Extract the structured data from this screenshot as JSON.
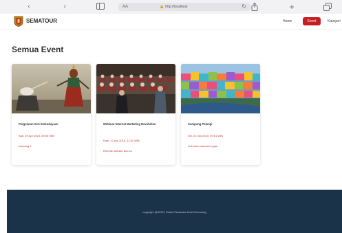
{
  "browser": {
    "text_size_label": "AA",
    "url": "http://localhost"
  },
  "navbar": {
    "brand": "SEMATOUR",
    "home_label": "Home",
    "event_label": "Event",
    "category_label": "Kategori"
  },
  "page": {
    "title": "Semua Event"
  },
  "events": [
    {
      "title": "Pergelaran Seni Kebudayaan",
      "date": "Sab, 29 Apr 2023, 09:00 WIB",
      "location": "simpang 5"
    },
    {
      "title": "Webinar Internet Marketing Revolution",
      "date": "Kam, 12 Apr 2018, 11:51 WIB",
      "location": "Remote website and co"
    },
    {
      "title": "Kampung Pelangi",
      "date": "Sel, 20 Jun 2023, 09:51 WIB",
      "location": "Jl.di atas sebelum tugas"
    }
  ],
  "footer": {
    "copyright": "copyright @2023 | Dinas Pariwisata Kota Semarang"
  },
  "colors": {
    "accent": "#c51f24",
    "footer_bg": "#1b3349",
    "date_text": "#c0392b"
  }
}
